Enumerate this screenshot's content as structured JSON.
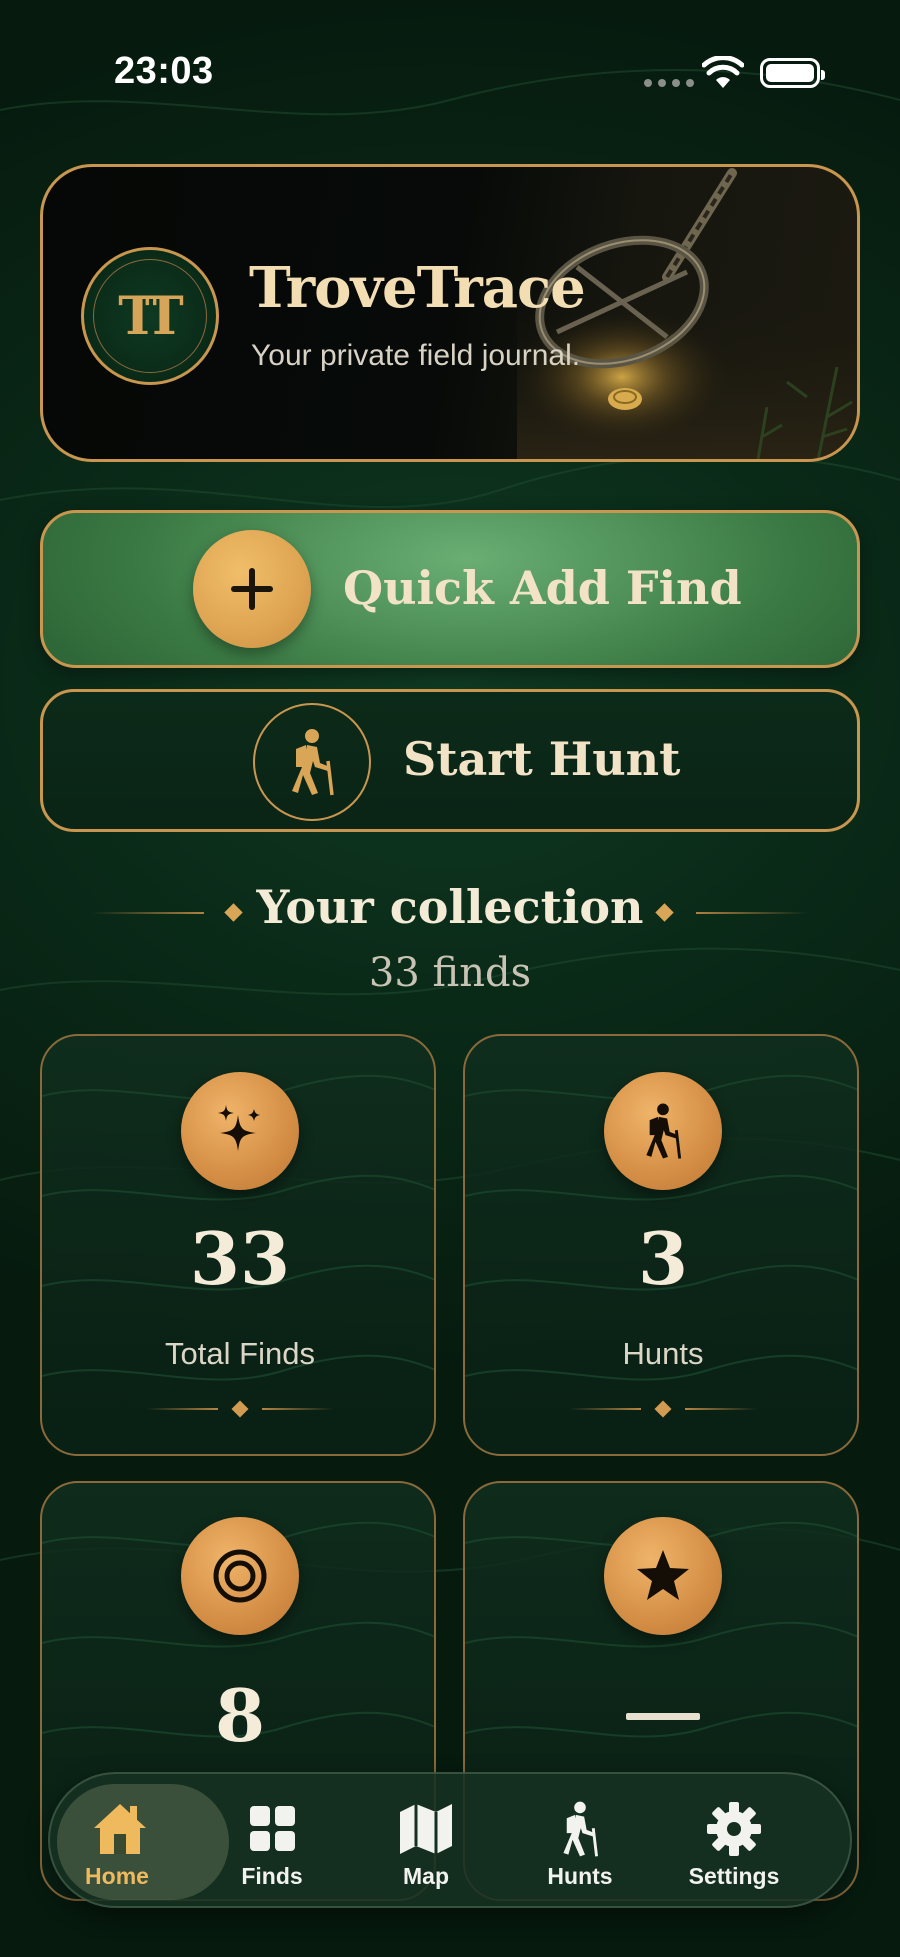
{
  "status_bar": {
    "time": "23:03"
  },
  "header": {
    "logo_text": "TT",
    "app_name": "TroveTrace",
    "tagline": "Your private field journal."
  },
  "actions": {
    "quick_add_label": "Quick Add Find",
    "start_hunt_label": "Start Hunt"
  },
  "collection": {
    "title": "Your collection",
    "count_text": "33 finds"
  },
  "stats": [
    {
      "icon": "sparkles-icon",
      "value": "33",
      "label": "Total Finds"
    },
    {
      "icon": "hiker-icon",
      "value": "3",
      "label": "Hunts"
    },
    {
      "icon": "target-icon",
      "value": "8"
    },
    {
      "icon": "star-icon",
      "value": ""
    }
  ],
  "tabs": [
    {
      "label": "Home",
      "icon": "home-icon",
      "active": true
    },
    {
      "label": "Finds",
      "icon": "grid-icon",
      "active": false
    },
    {
      "label": "Map",
      "icon": "map-icon",
      "active": false
    },
    {
      "label": "Hunts",
      "icon": "hiker-icon",
      "active": false
    },
    {
      "label": "Settings",
      "icon": "gear-icon",
      "active": false
    }
  ],
  "colors": {
    "accent_gold": "#c9964f",
    "badge_orange": "#d48e45",
    "quick_add_green": "#4f9158",
    "background_green": "#0a2a18",
    "active_tab": "#efba5e"
  }
}
